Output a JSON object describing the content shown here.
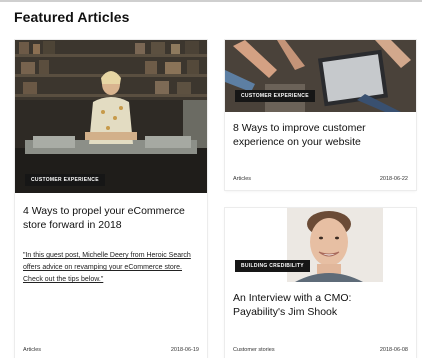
{
  "section": {
    "title": "Featured Articles"
  },
  "articles": [
    {
      "badge": "CUSTOMER EXPERIENCE",
      "title": "4 Ways to propel your eCommerce store forward in 2018",
      "excerpt": "\"In this guest post, Michelle Deery from Heroic Search offers advice on revamping your eCommerce store. Check out the tips below.\"",
      "category": "Articles",
      "date": "2018-06-19",
      "image": "shop-worker-photo"
    },
    {
      "badge": "CUSTOMER EXPERIENCE",
      "title": "8 Ways to improve customer experience on your website",
      "category": "Articles",
      "date": "2018-06-22",
      "image": "laptop-hands-photo"
    },
    {
      "badge": "BUILDING CREDIBILITY",
      "title": "An Interview with a CMO: Payability's Jim Shook",
      "category": "Customer stories",
      "date": "2018-06-08",
      "image": "portrait-photo"
    }
  ]
}
